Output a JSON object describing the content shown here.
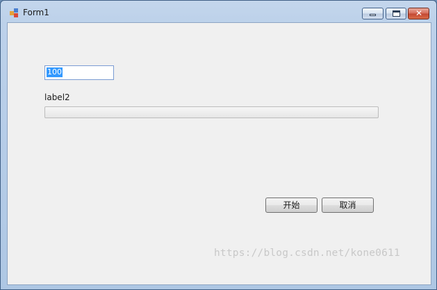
{
  "window": {
    "title": "Form1",
    "controls": {
      "minimize": "minimize",
      "maximize": "maximize",
      "close": "close"
    }
  },
  "form": {
    "input_value": "100",
    "label": "label2",
    "progress": 0,
    "start_label": "开始",
    "cancel_label": "取消"
  },
  "watermark": "https://blog.csdn.net/kone0611",
  "colors": {
    "selection": "#3399ff",
    "client_bg": "#f0f0f0",
    "close_button": "#c44a33"
  }
}
